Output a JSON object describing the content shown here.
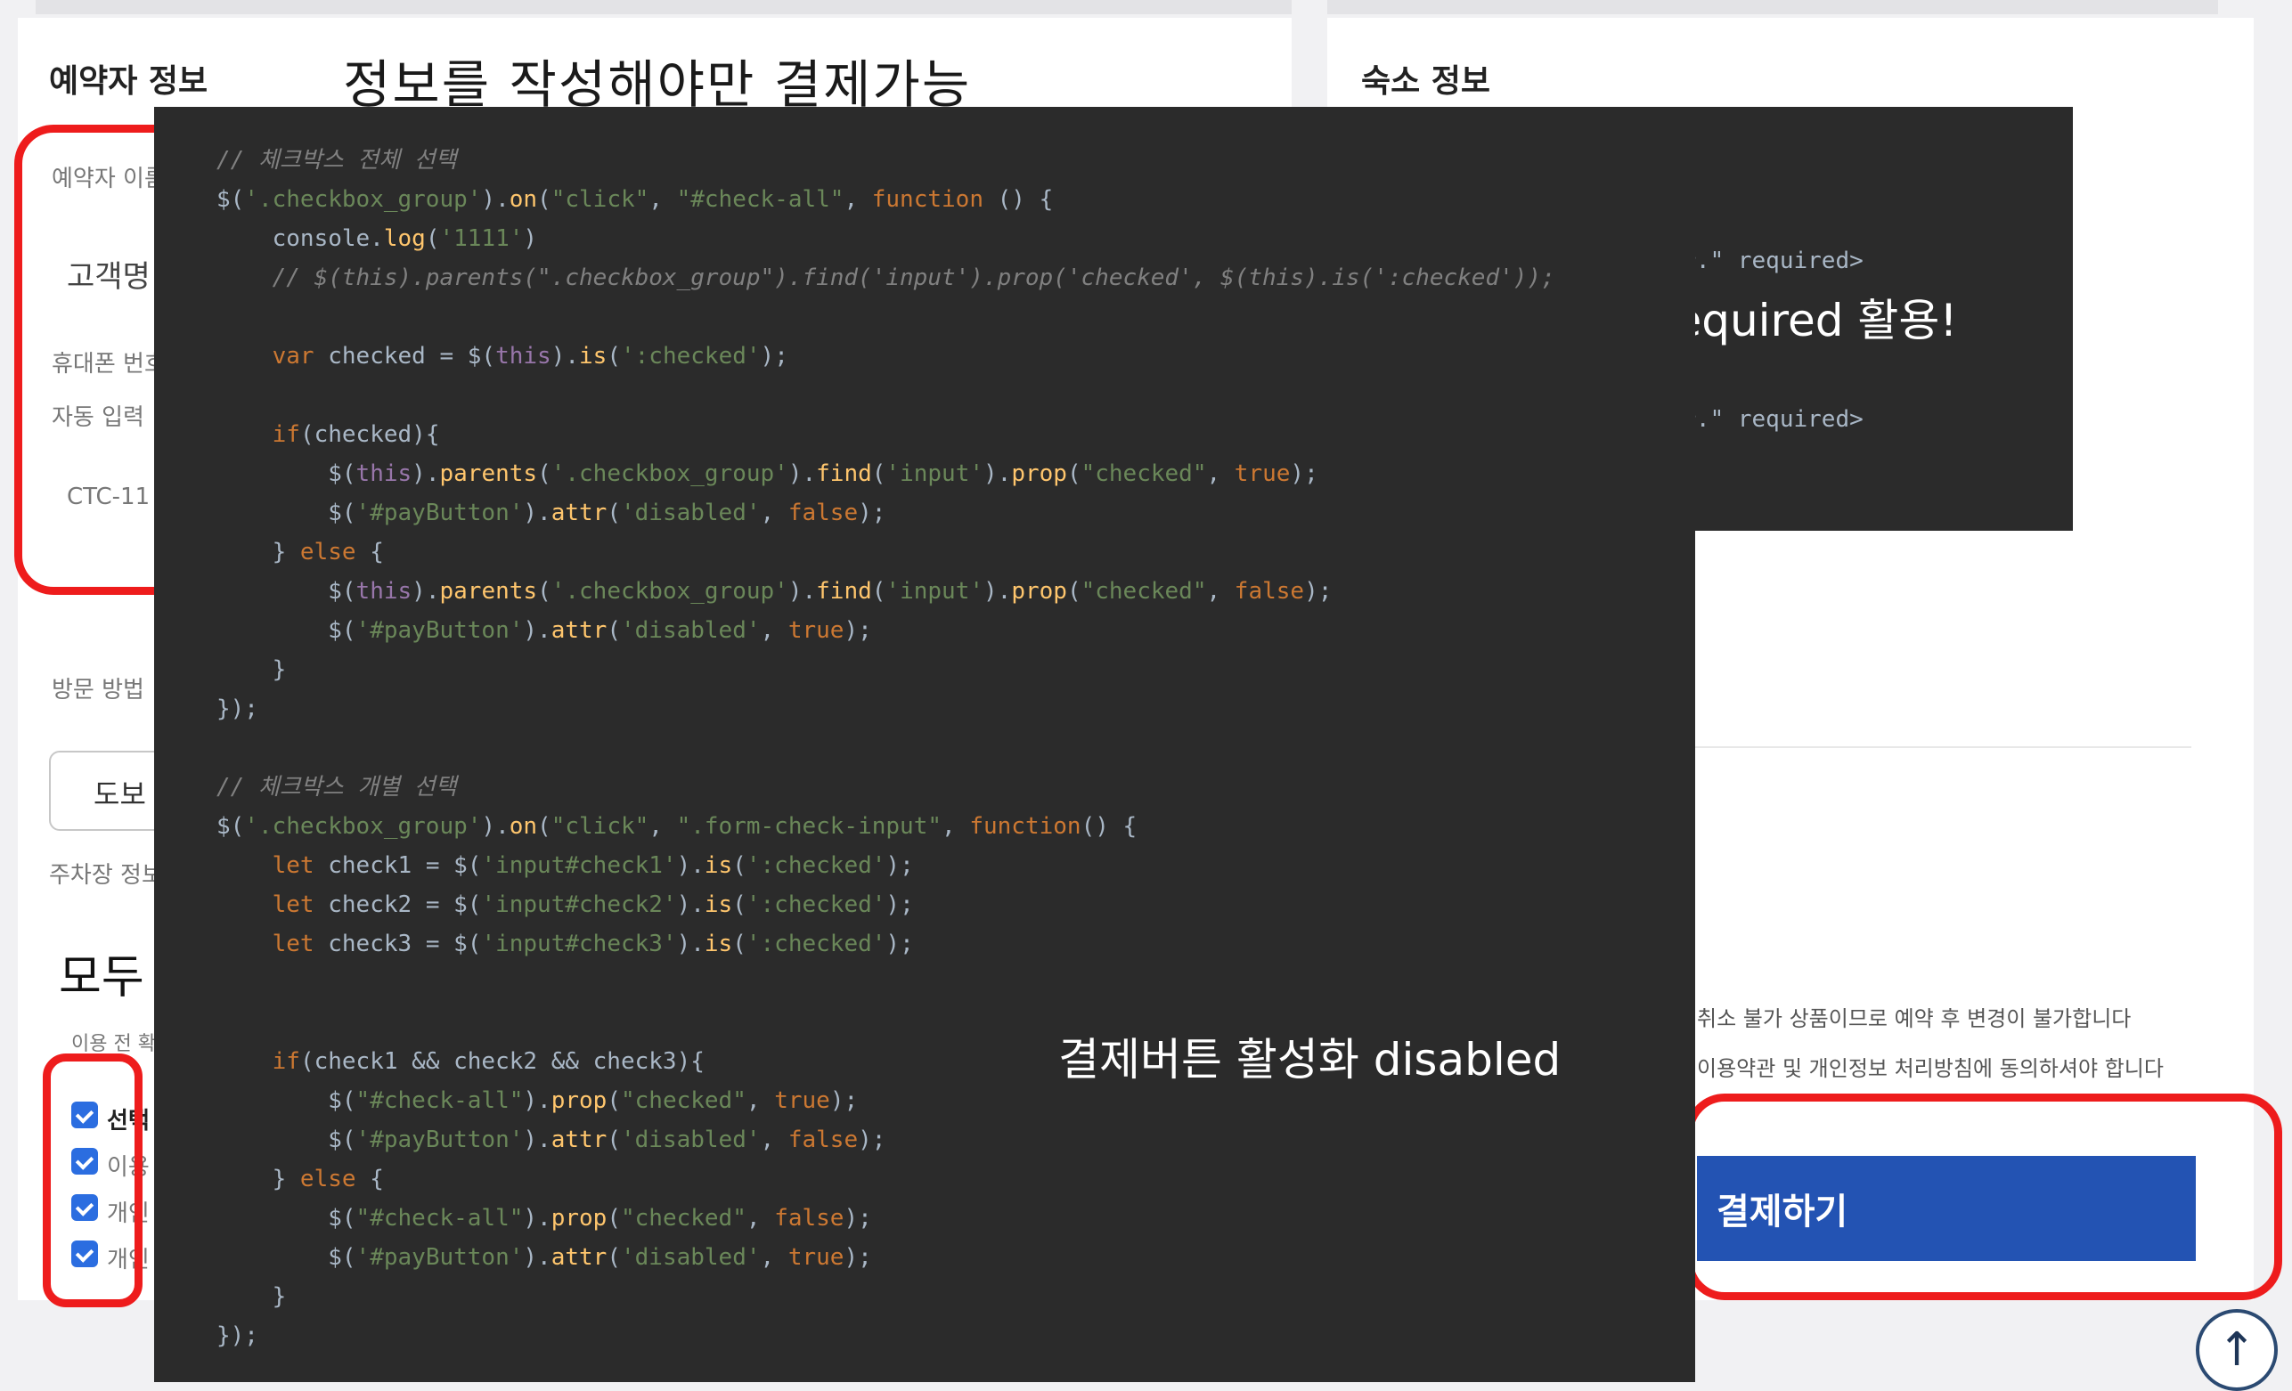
{
  "left_panel": {
    "title": "예약자 정보",
    "annotation": "정보를 작성해야만 결제가능",
    "faded_lines": [
      "예약자 이름",
      "고객명",
      "휴대폰 번호",
      "자동 입력",
      "CTC-11"
    ],
    "visitor_section": "방문 방법",
    "visitor_button": "도보",
    "visitor_note": "주차장 정보",
    "all_agree_label": "모두",
    "terms_note": "이용 전 확인",
    "checkbox_labels": [
      "선택",
      "이용",
      "개인",
      "개인"
    ]
  },
  "right_panel": {
    "title": "숙소 정보",
    "notice_lines": [
      "취소 불가 상품이므로 예약 후 변경이 불가합니다",
      "이용약관 및 개인정보 처리방침에 동의하셔야 합니다"
    ],
    "pay_button": "결제하기"
  },
  "code_overlay_small": {
    "line1": "다.\" required>",
    "annotation": "required 활용!",
    "line2": "다.\" required>"
  },
  "code_annotation": "결제버튼 활성화 disabled",
  "code_lines": [
    "// 체크박스 전체 선택",
    "$('.checkbox_group').on(\"click\", \"#check-all\", function () {",
    "    console.log('1111')",
    "    // $(this).parents(\".checkbox_group\").find('input').prop('checked', $(this).is(':checked'));",
    "",
    "    var checked = $(this).is(':checked');",
    "",
    "    if(checked){",
    "        $(this).parents('.checkbox_group').find('input').prop(\"checked\", true);",
    "        $('#payButton').attr('disabled', false);",
    "    } else {",
    "        $(this).parents('.checkbox_group').find('input').prop(\"checked\", false);",
    "        $('#payButton').attr('disabled', true);",
    "    }",
    "});",
    "",
    "// 체크박스 개별 선택",
    "$('.checkbox_group').on(\"click\", \".form-check-input\", function() {",
    "    let check1 = $('input#check1').is(':checked');",
    "    let check2 = $('input#check2').is(':checked');",
    "    let check3 = $('input#check3').is(':checked');",
    "",
    "",
    "    if(check1 && check2 && check3){",
    "        $(\"#check-all\").prop(\"checked\", true);",
    "        $('#payButton').attr('disabled', false);",
    "    } else {",
    "        $(\"#check-all\").prop(\"checked\", false);",
    "        $('#payButton').attr('disabled', true);",
    "    }",
    "});"
  ],
  "scroll_top_icon": "arrow-up-icon",
  "colors": {
    "accent": "#2353b3",
    "highlight": "#ee1c1c",
    "editor_bg": "#2b2b2b"
  }
}
